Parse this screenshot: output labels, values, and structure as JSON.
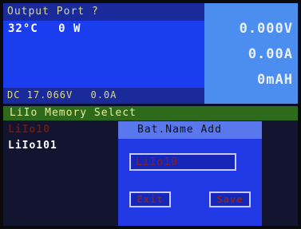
{
  "output": {
    "title": "Output Port ?",
    "temperature": "32°C",
    "power": "0 W",
    "voltage": "DC 17.066V",
    "current": "0.0A"
  },
  "readout": {
    "voltage": "0.000V",
    "current": "0.00A",
    "capacity": "0mAH"
  },
  "memory": {
    "title": "LiIo Memory Select",
    "items": [
      "LiIo10",
      "LiIo101"
    ]
  },
  "dialog": {
    "title": "Bat.Name Add",
    "name_value": "LiIo10",
    "exit_label": "Exit",
    "save_label": "Save"
  }
}
